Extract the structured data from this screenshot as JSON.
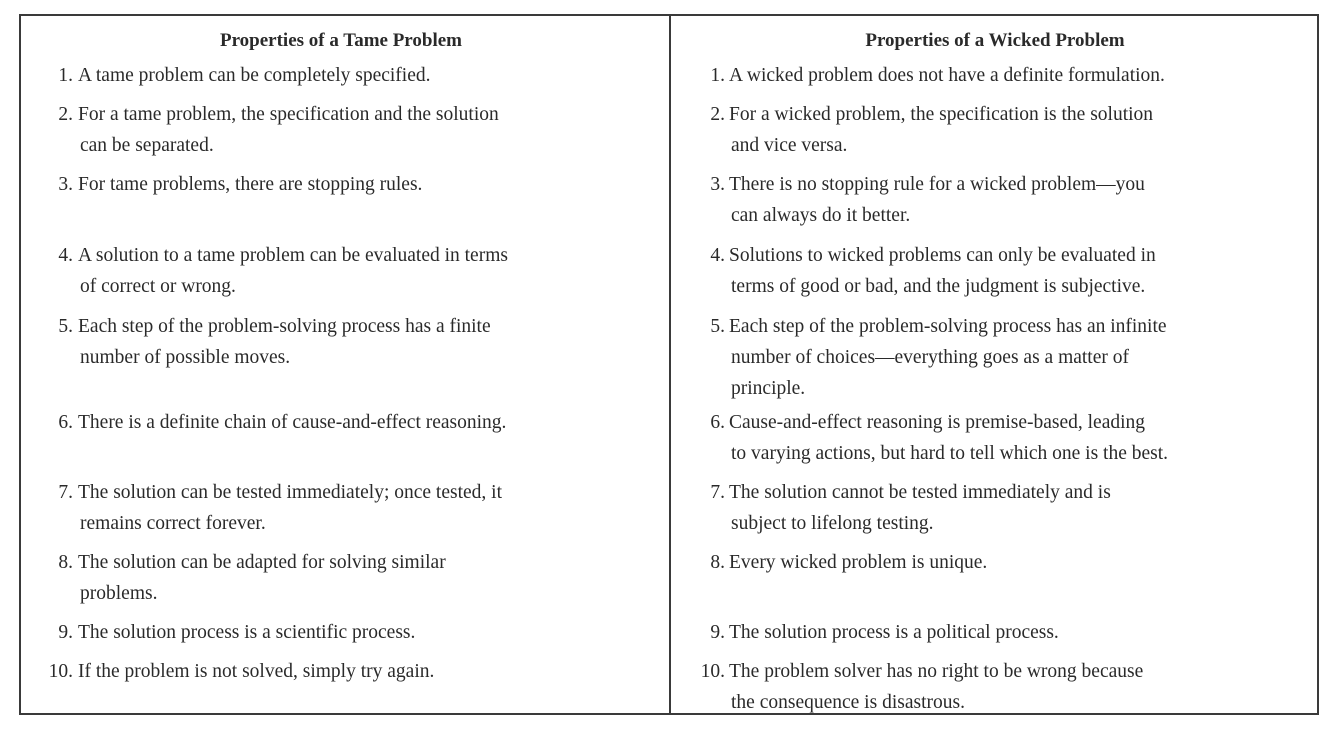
{
  "tame": {
    "header": "Properties of a Tame Problem",
    "items": [
      {
        "num": "1.",
        "lines": [
          "A tame problem can be completely specified."
        ]
      },
      {
        "num": "2.",
        "lines": [
          "For a tame problem, the specification and the solution",
          "can be separated."
        ]
      },
      {
        "num": "3.",
        "lines": [
          "For tame problems, there are stopping rules."
        ]
      },
      {
        "num": "4.",
        "lines": [
          "A solution to a tame problem can be evaluated in terms",
          "of correct or wrong."
        ]
      },
      {
        "num": "5.",
        "lines": [
          "Each step of the problem-solving process has a finite",
          "number of possible moves."
        ]
      },
      {
        "num": "6.",
        "lines": [
          "There is a definite chain of cause-and-effect reasoning."
        ]
      },
      {
        "num": "7.",
        "lines": [
          "The solution can be tested immediately; once tested, it",
          "remains correct forever."
        ]
      },
      {
        "num": "8.",
        "lines": [
          "The solution can be adapted for solving similar",
          "problems."
        ]
      },
      {
        "num": "9.",
        "lines": [
          "The solution process is a scientific process."
        ]
      },
      {
        "num": "10.",
        "lines": [
          "If the problem is not solved, simply try again."
        ]
      }
    ]
  },
  "wicked": {
    "header": "Properties of a Wicked Problem",
    "items": [
      {
        "num": "1.",
        "lines": [
          "A wicked problem does not have a definite formulation."
        ]
      },
      {
        "num": "2.",
        "lines": [
          "For a wicked problem, the specification is the solution",
          "and vice versa."
        ]
      },
      {
        "num": "3.",
        "lines": [
          "There is no stopping rule for a wicked problem—you",
          "can always do it better."
        ]
      },
      {
        "num": "4.",
        "lines": [
          "Solutions to wicked problems can only be evaluated in",
          "terms of good or bad, and the judgment is subjective."
        ]
      },
      {
        "num": "5.",
        "lines": [
          "Each step of the problem-solving process has an infinite",
          "number of choices—everything goes as a matter of",
          "principle."
        ]
      },
      {
        "num": "6.",
        "lines": [
          "Cause-and-effect reasoning is premise-based, leading",
          "to varying actions, but hard to tell which one is the best."
        ]
      },
      {
        "num": "7.",
        "lines": [
          "The solution cannot be tested immediately and is",
          "subject to lifelong testing."
        ]
      },
      {
        "num": "8.",
        "lines": [
          "Every wicked problem is unique."
        ]
      },
      {
        "num": "9.",
        "lines": [
          "The solution process is a political process."
        ]
      },
      {
        "num": "10.",
        "lines": [
          "The problem solver has no right to be wrong because",
          "the consequence is disastrous."
        ]
      }
    ]
  }
}
